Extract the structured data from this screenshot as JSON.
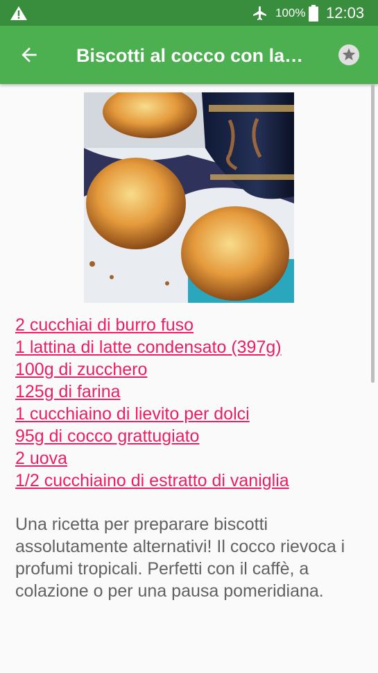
{
  "status_bar": {
    "battery_percent": "100%",
    "time": "12:03",
    "icons": [
      "warning-icon",
      "airplane-mode-icon",
      "battery-full-icon"
    ]
  },
  "app_bar": {
    "title": "Biscotti al cocco con la…",
    "back_icon": "arrow-back-icon",
    "favorite_icon": "star-icon",
    "color": "#4caf50",
    "status_color": "#388e3c"
  },
  "recipe": {
    "image_alt": "coconut cookies photo",
    "ingredients": [
      "2 cucchiai di burro fuso",
      "1 lattina di latte condensato (397g)",
      "100g di zucchero",
      "125g di farina",
      "1 cucchiaino di lievito per dolci",
      "95g di cocco grattugiato",
      "2 uova",
      "1/2 cucchiaino di estratto di vaniglia"
    ],
    "description": "Una ricetta per preparare biscotti assolutamente alternativi! Il cocco rievoca i profumi tropicali. Perfetti con il caffè, a colazione o per una pausa pomeridiana.",
    "link_color": "#e91e63",
    "text_color": "#616161"
  }
}
